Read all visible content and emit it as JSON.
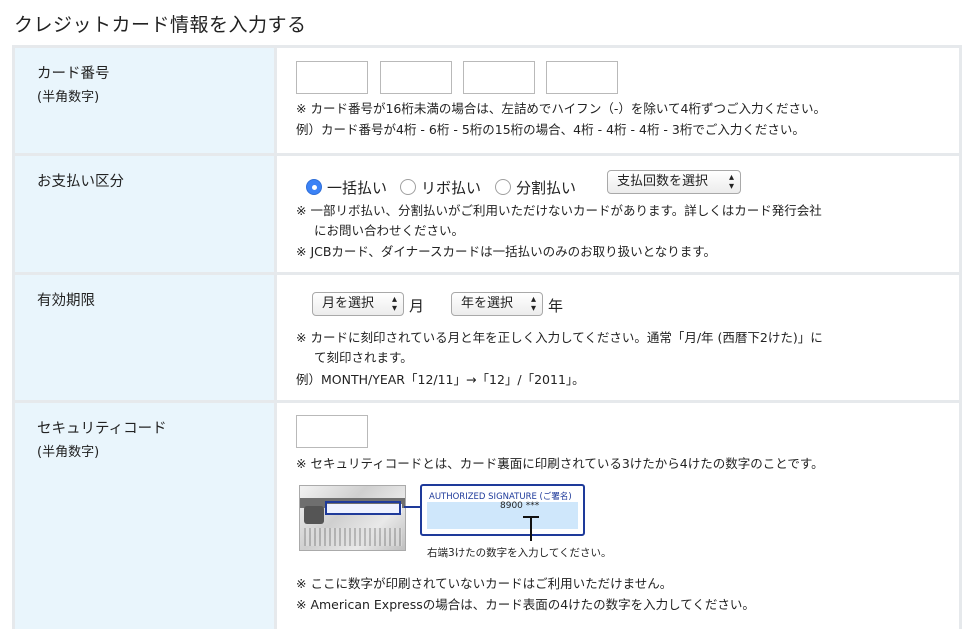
{
  "page": {
    "title": "クレジットカード情報を入力する"
  },
  "card_number": {
    "label": "カード番号",
    "sublabel": "(半角数字)",
    "note1": "※ カード番号が16桁未満の場合は、左詰めでハイフン（-）を除いて4桁ずつご入力ください。",
    "note2": "例）カード番号が4桁 - 6桁 - 5桁の15桁の場合、4桁 - 4桁 - 4桁 - 3桁でご入力ください。"
  },
  "payment": {
    "label": "お支払い区分",
    "options": [
      "一括払い",
      "リボ払い",
      "分割払い"
    ],
    "selected_index": 0,
    "installments_select": "支払回数を選択",
    "note1": "※ 一部リボ払い、分割払いがご利用いただけないカードがあります。詳しくはカード発行会社",
    "note1b": "にお問い合わせください。",
    "note2": "※ JCBカード、ダイナースカードは一括払いのみのお取り扱いとなります。"
  },
  "expiry": {
    "label": "有効期限",
    "month_select": "月を選択",
    "month_unit": "月",
    "year_select": "年を選択",
    "year_unit": "年",
    "note1": "※ カードに刻印されている月と年を正しく入力してください。通常「月/年 (西暦下2けた)」に",
    "note1b": "て刻印されます。",
    "note2": "例）MONTH/YEAR「12/11」→「12」/「2011」。"
  },
  "security_code": {
    "label": "セキュリティコード",
    "sublabel": "(半角数字)",
    "note1": "※ セキュリティコードとは、カード裏面に印刷されている3けたから4けたの数字のことです。",
    "illustration": {
      "sig_title": "AUTHORIZED SIGNATURE (ご署名)",
      "sig_number": "8900 ***",
      "caption": "右端3けたの数字を入力してください。"
    },
    "note2": "※ ここに数字が印刷されていないカードはご利用いただけません。",
    "note3": "※ American Expressの場合は、カード表面の4けたの数字を入力してください。"
  },
  "colors": {
    "label_bg": "#e9f5fc",
    "border": "#e6e9ec",
    "radio_on": "#3b82f6",
    "illustration_blue": "#1e3a9a"
  }
}
